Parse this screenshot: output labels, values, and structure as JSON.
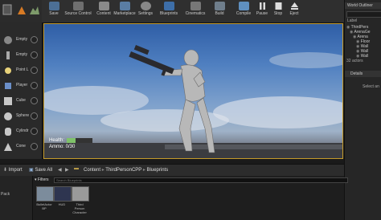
{
  "toolbar": {
    "items": [
      {
        "label": "Save",
        "icon": "save-icon"
      },
      {
        "label": "Source Control",
        "icon": "source-control-icon"
      },
      {
        "label": "Content",
        "icon": "content-icon"
      },
      {
        "label": "Marketplace",
        "icon": "marketplace-icon"
      },
      {
        "label": "Settings",
        "icon": "settings-icon"
      },
      {
        "label": "Blueprints",
        "icon": "blueprints-icon"
      },
      {
        "label": "Cinematics",
        "icon": "cinematics-icon"
      },
      {
        "label": "Build",
        "icon": "build-icon"
      },
      {
        "label": "Compile",
        "icon": "compile-icon"
      },
      {
        "label": "Pause",
        "icon": "pause-icon"
      },
      {
        "label": "Stop",
        "icon": "stop-icon"
      },
      {
        "label": "Eject",
        "icon": "eject-icon"
      }
    ]
  },
  "place_panel": {
    "items": [
      {
        "label": "Empty"
      },
      {
        "label": "Empty"
      },
      {
        "label": "Point L"
      },
      {
        "label": "Player"
      },
      {
        "label": "Cube"
      },
      {
        "label": "Sphere"
      },
      {
        "label": "Cylindr"
      },
      {
        "label": "Cone"
      }
    ]
  },
  "viewport": {
    "health_label": "Health:",
    "health_fraction": 0.35,
    "ammo_label": "Ammo: 0/30"
  },
  "world_outliner": {
    "title": "World Outliner",
    "column": "Label",
    "rows": [
      "ThirdPers",
      "ArenaGe",
      "Arena",
      "Floor",
      "Wall",
      "Wall",
      "Wall"
    ],
    "count": "32 actors",
    "details_title": "Details",
    "details_hint": "Select an"
  },
  "content_browser": {
    "import_label": "Import",
    "save_all_label": "Save All",
    "path": [
      "Content",
      "ThirdPersonCPP",
      "Blueprints"
    ],
    "filters_label": "Filters",
    "search_placeholder": "Search Blueprints",
    "left_label": "Pack",
    "assets": [
      {
        "name": "BulletActor BP"
      },
      {
        "name": "HUD"
      },
      {
        "name": "Third Person Character"
      }
    ]
  },
  "colors": {
    "accent": "#c49a2a",
    "health": "#7fc26a"
  }
}
